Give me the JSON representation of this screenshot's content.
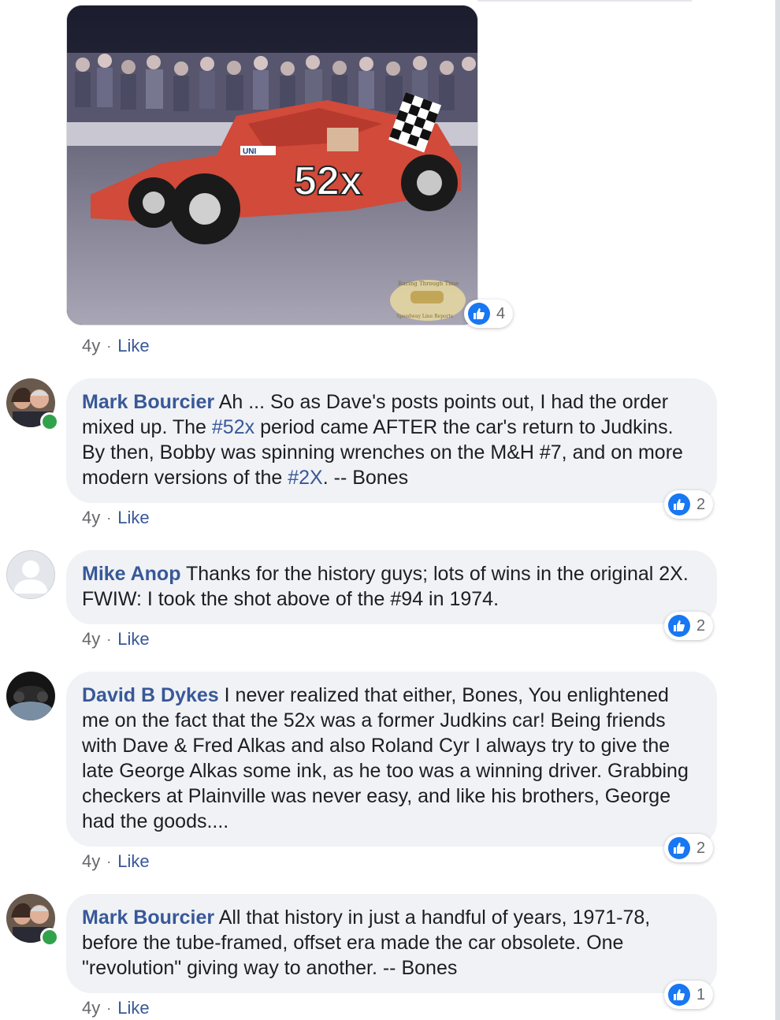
{
  "top_item": {
    "time": "4y",
    "like_label": "Like",
    "reaction_count": "4"
  },
  "comments": [
    {
      "author": "Mark Bourcier",
      "text_parts": [
        "Ah ... So as Dave's posts points out, I had the order mixed up. The ",
        "#52x",
        " period came AFTER the car's return to Judkins. By then, Bobby was spinning wrenches on the M&H #7, and on more modern versions of the ",
        "#2X",
        ". -- Bones"
      ],
      "time": "4y",
      "like_label": "Like",
      "reaction_count": "2"
    },
    {
      "author": "Mike Anop",
      "text": "Thanks for the history guys; lots of wins in the original 2X. FWIW: I took the shot above of the #94 in 1974.",
      "time": "4y",
      "like_label": "Like",
      "reaction_count": "2"
    },
    {
      "author": "David B Dykes",
      "text": "I never realized that either, Bones, You enlightened me on the fact that the 52x was a former Judkins car! Being friends with Dave & Fred Alkas and also Roland Cyr I always try to give the late George Alkas some ink, as he too was a winning driver. Grabbing checkers at Plainville was never easy, and like his brothers, George had the goods....",
      "time": "4y",
      "like_label": "Like",
      "reaction_count": "2"
    },
    {
      "author": "Mark Bourcier",
      "text": "All that history in just a handful of years, 1971-78, before the tube-framed, offset era made the car obsolete. One \"revolution\" giving way to another. -- Bones",
      "time": "4y",
      "like_label": "Like",
      "reaction_count": "1"
    }
  ],
  "photo": {
    "car_number": "52x",
    "sponsor_text": "UNI",
    "watermark_text": "Racing Through Time",
    "watermark_sub": "Speedway Line Reports"
  },
  "colors": {
    "link": "#385898",
    "bubble": "#f0f2f5",
    "like_blue": "#1877f2",
    "online": "#31a24c"
  },
  "icons": [
    "thumbs-up-icon",
    "avatar-photo",
    "default-avatar-icon",
    "online-indicator"
  ]
}
